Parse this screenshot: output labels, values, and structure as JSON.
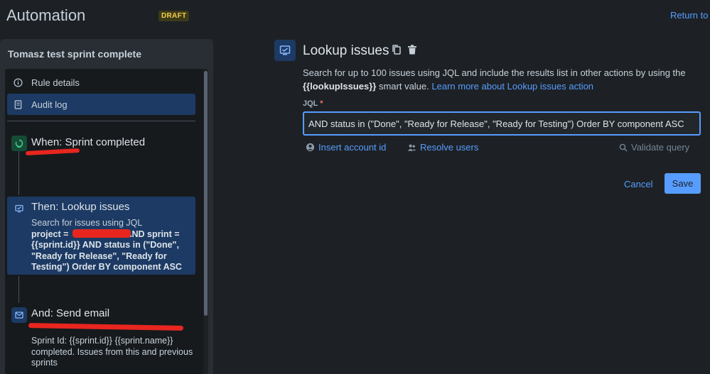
{
  "header": {
    "title": "Automation",
    "draft_badge": "DRAFT",
    "return_link": "Return to"
  },
  "sidebar": {
    "rule_name": "Tomasz test sprint complete",
    "menu": {
      "rule_details": "Rule details",
      "audit_log": "Audit log"
    },
    "steps": [
      {
        "title": "When: Sprint completed",
        "icon": "trigger-icon"
      },
      {
        "title": "Then: Lookup issues",
        "icon": "lookup-icon",
        "desc_intro": "Search for issues using JQL",
        "desc_line1_start": "project =",
        "desc_line1_end": "AND sprint =",
        "desc_rest": "{{sprint.id}} AND status in (\"Done\", \"Ready for Release\", \"Ready for Testing\") Order BY component ASC"
      },
      {
        "title": "And: Send email",
        "icon": "mail-icon",
        "desc": "Sprint Id: {{sprint.id}} {{sprint.name}} completed. Issues from this and previous sprints"
      }
    ]
  },
  "detail": {
    "title": "Lookup issues",
    "desc_part1": "Search for up to 100 issues using JQL and include the results list in other actions by using the",
    "desc_smart_value": "{{lookupIssues}}",
    "desc_part2": "smart value.",
    "desc_link": "Learn more about Lookup issues action",
    "jql_label": "JQL",
    "jql_required": "*",
    "jql_value": "AND status in (\"Done\", \"Ready for Release\", \"Ready for Testing\") Order BY component ASC",
    "insert_account": "Insert account id",
    "resolve_users": "Resolve users",
    "validate_query": "Validate query",
    "cancel": "Cancel",
    "save": "Save"
  },
  "colors": {
    "accent": "#579dff",
    "selected_bg": "#1c3a63",
    "redaction": "#e8261f",
    "draft": "#f5cd47"
  }
}
